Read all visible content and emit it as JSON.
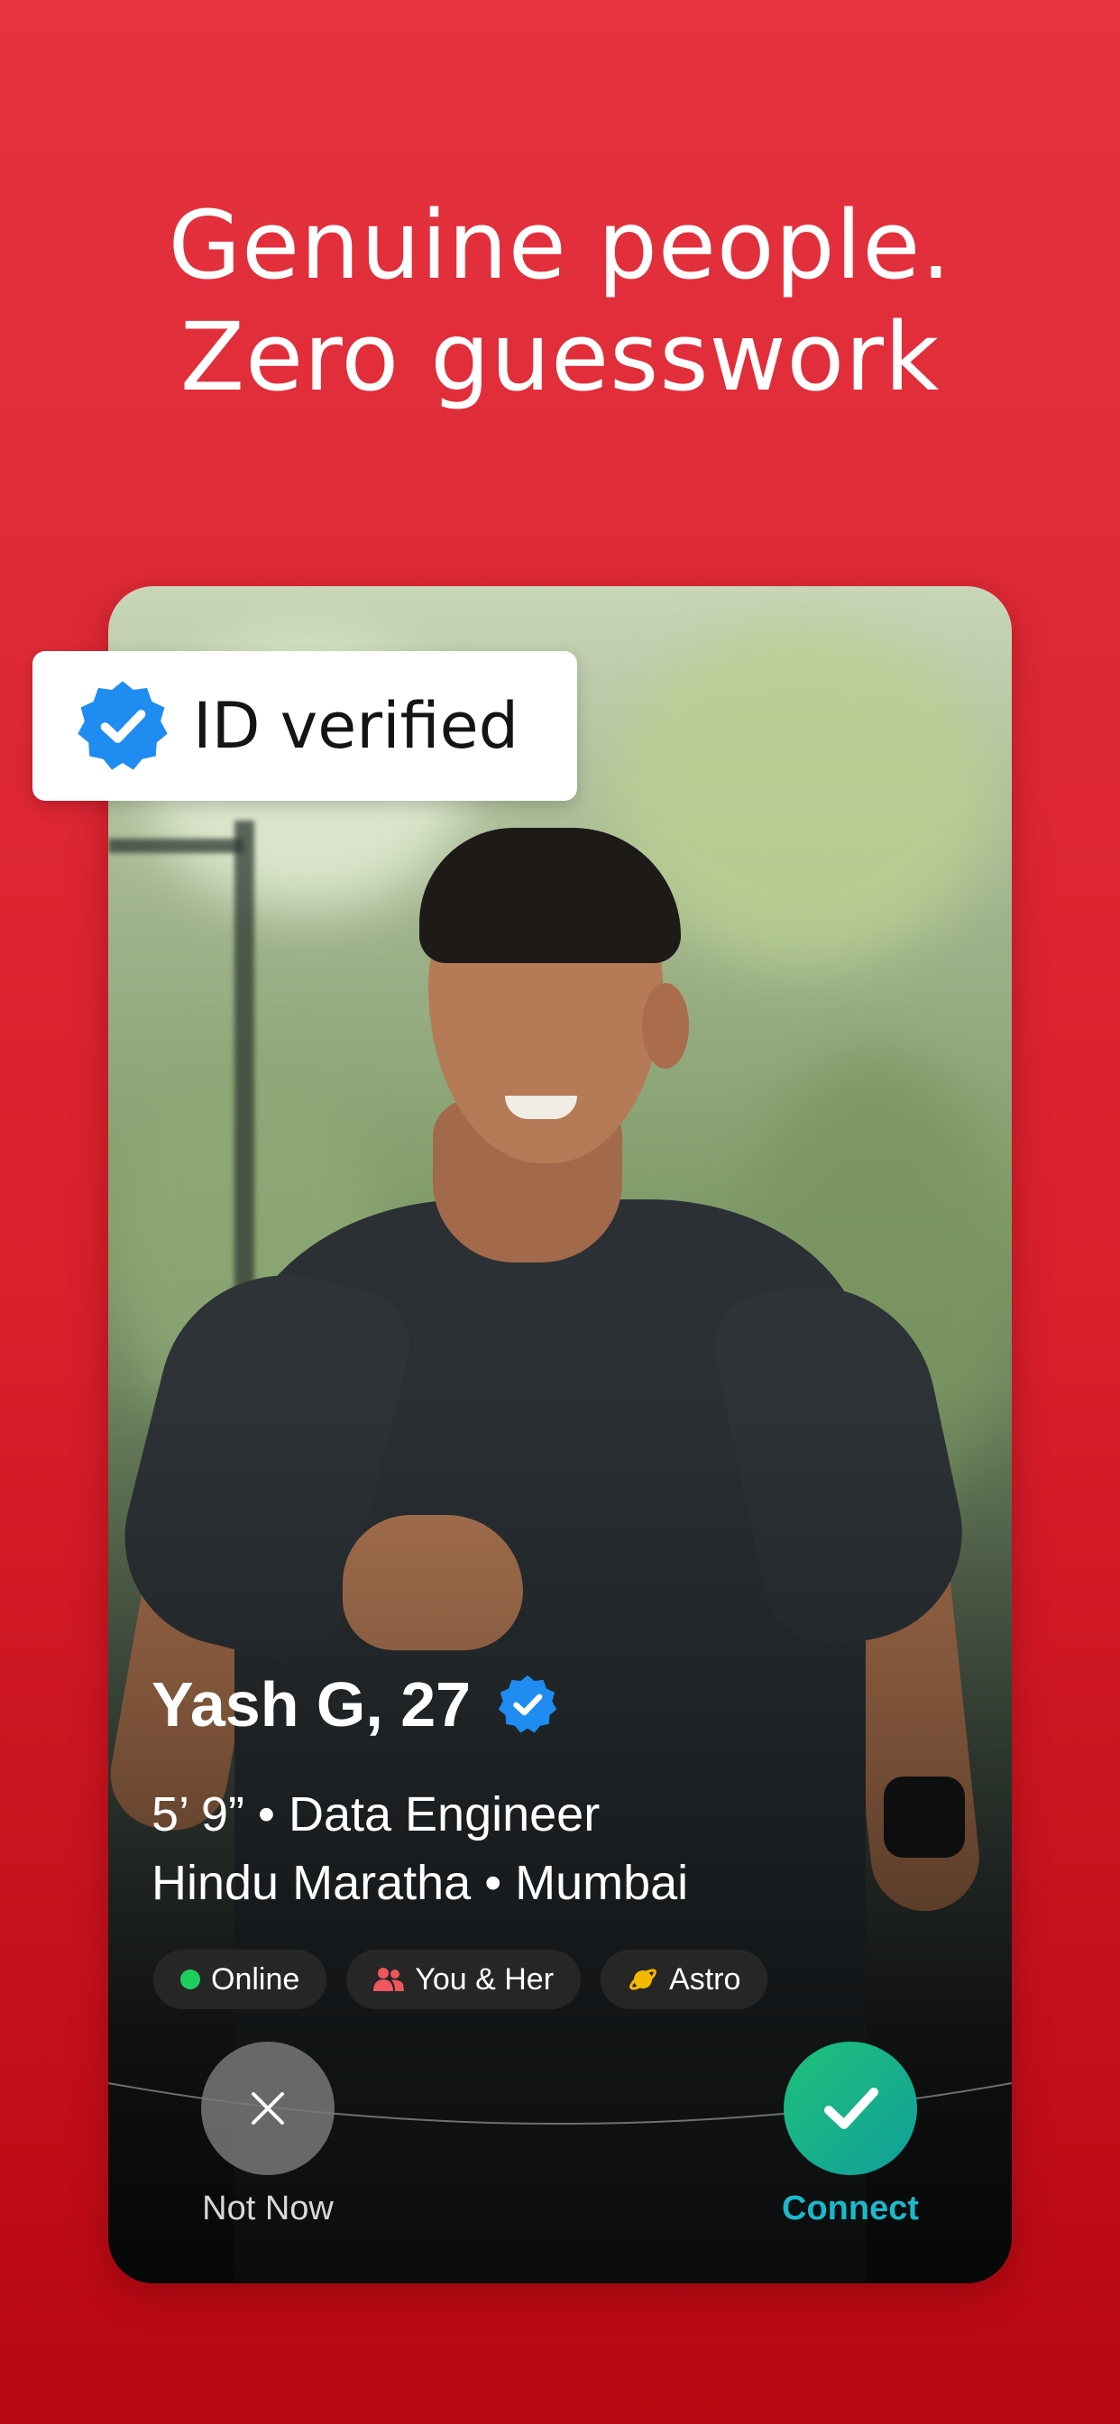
{
  "headline": {
    "line1": "Genuine people.",
    "line2": "Zero guesswork"
  },
  "badge": {
    "label": "ID verified",
    "icon": "verified-badge-icon",
    "color": "#1e8cf0"
  },
  "profile": {
    "name_age": "Yash G, 27",
    "verified_icon": "verified-badge-icon",
    "details_line1": "5’ 9” • Data Engineer",
    "details_line2": "Hindu Maratha • Mumbai",
    "tags": [
      {
        "icon": "online-dot-icon",
        "label": "Online"
      },
      {
        "icon": "people-icon",
        "label": "You & Her"
      },
      {
        "icon": "planet-icon",
        "label": "Astro"
      }
    ]
  },
  "actions": {
    "decline_label": "Not Now",
    "accept_label": "Connect"
  },
  "colors": {
    "background": "#d91e2c",
    "online": "#1fcf5e",
    "connect_text": "#1ab9c9",
    "connect_button": "#13b08a"
  }
}
